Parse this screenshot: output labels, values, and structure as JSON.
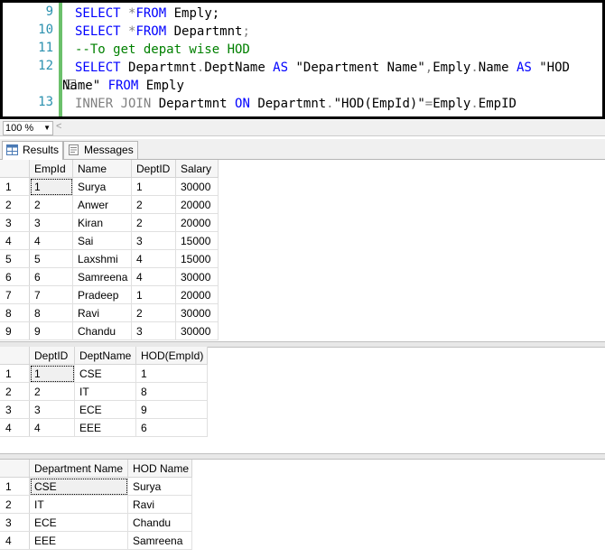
{
  "editor": {
    "line_numbers": [
      "9",
      "10",
      "11",
      "12",
      "",
      "13"
    ],
    "lines": [
      [
        {
          "t": "SELECT ",
          "c": "kw"
        },
        {
          "t": "*",
          "c": "gray"
        },
        {
          "t": "FROM ",
          "c": "kw"
        },
        {
          "t": "Emply;",
          "c": ""
        }
      ],
      [
        {
          "t": "SELECT ",
          "c": "kw"
        },
        {
          "t": "*",
          "c": "gray"
        },
        {
          "t": "FROM ",
          "c": "kw"
        },
        {
          "t": "Departmnt",
          "c": ""
        },
        {
          "t": ";",
          "c": "gray"
        }
      ],
      [
        {
          "t": "--To get depat wise HOD",
          "c": "green"
        }
      ],
      [
        {
          "t": "SELECT ",
          "c": "kw"
        },
        {
          "t": "Departmnt",
          "c": ""
        },
        {
          "t": ".",
          "c": "gray"
        },
        {
          "t": "DeptName ",
          "c": ""
        },
        {
          "t": "AS ",
          "c": "kw"
        },
        {
          "t": "\"Department Name\"",
          "c": ""
        },
        {
          "t": ",",
          "c": "gray"
        },
        {
          "t": "Emply",
          "c": ""
        },
        {
          "t": ".",
          "c": "gray"
        },
        {
          "t": "Name ",
          "c": ""
        },
        {
          "t": "AS ",
          "c": "kw"
        },
        {
          "t": "\"HOD",
          "c": ""
        }
      ],
      [
        {
          "t": "Name\" ",
          "c": ""
        },
        {
          "t": "FROM ",
          "c": "kw"
        },
        {
          "t": "Emply",
          "c": ""
        }
      ],
      [
        {
          "t": "INNER JOIN ",
          "c": "gray"
        },
        {
          "t": "Departmnt ",
          "c": ""
        },
        {
          "t": "ON ",
          "c": "kw"
        },
        {
          "t": "Departmnt",
          "c": ""
        },
        {
          "t": ".",
          "c": "gray"
        },
        {
          "t": "\"HOD(EmpId)\"",
          "c": ""
        },
        {
          "t": "=",
          "c": "gray"
        },
        {
          "t": "Emply",
          "c": ""
        },
        {
          "t": ".",
          "c": "gray"
        },
        {
          "t": "EmpID",
          "c": ""
        }
      ]
    ]
  },
  "zoom": {
    "value": "100 %",
    "arrow": "▼",
    "scroll_arrow": "<"
  },
  "tabs": [
    {
      "label": "Results",
      "icon": "grid-icon",
      "active": true
    },
    {
      "label": "Messages",
      "icon": "messages-icon",
      "active": false
    }
  ],
  "result1": {
    "columns": [
      "EmpId",
      "Name",
      "DeptID",
      "Salary"
    ],
    "rows": [
      [
        "1",
        "Surya",
        "1",
        "30000"
      ],
      [
        "2",
        "Anwer",
        "2",
        "20000"
      ],
      [
        "3",
        "Kiran",
        "2",
        "20000"
      ],
      [
        "4",
        "Sai",
        "3",
        "15000"
      ],
      [
        "5",
        "Laxshmi",
        "4",
        "15000"
      ],
      [
        "6",
        "Samreena",
        "4",
        "30000"
      ],
      [
        "7",
        "Pradeep",
        "1",
        "20000"
      ],
      [
        "8",
        "Ravi",
        "2",
        "30000"
      ],
      [
        "9",
        "Chandu",
        "3",
        "30000"
      ]
    ]
  },
  "result2": {
    "columns": [
      "DeptID",
      "DeptName",
      "HOD(EmpId)"
    ],
    "rows": [
      [
        "1",
        "CSE",
        "1"
      ],
      [
        "2",
        "IT",
        "8"
      ],
      [
        "3",
        "ECE",
        "9"
      ],
      [
        "4",
        "EEE",
        "6"
      ]
    ]
  },
  "result3": {
    "columns": [
      "Department Name",
      "HOD Name"
    ],
    "rows": [
      [
        "CSE",
        "Surya"
      ],
      [
        "IT",
        "Ravi"
      ],
      [
        "ECE",
        "Chandu"
      ],
      [
        "EEE",
        "Samreena"
      ]
    ]
  }
}
